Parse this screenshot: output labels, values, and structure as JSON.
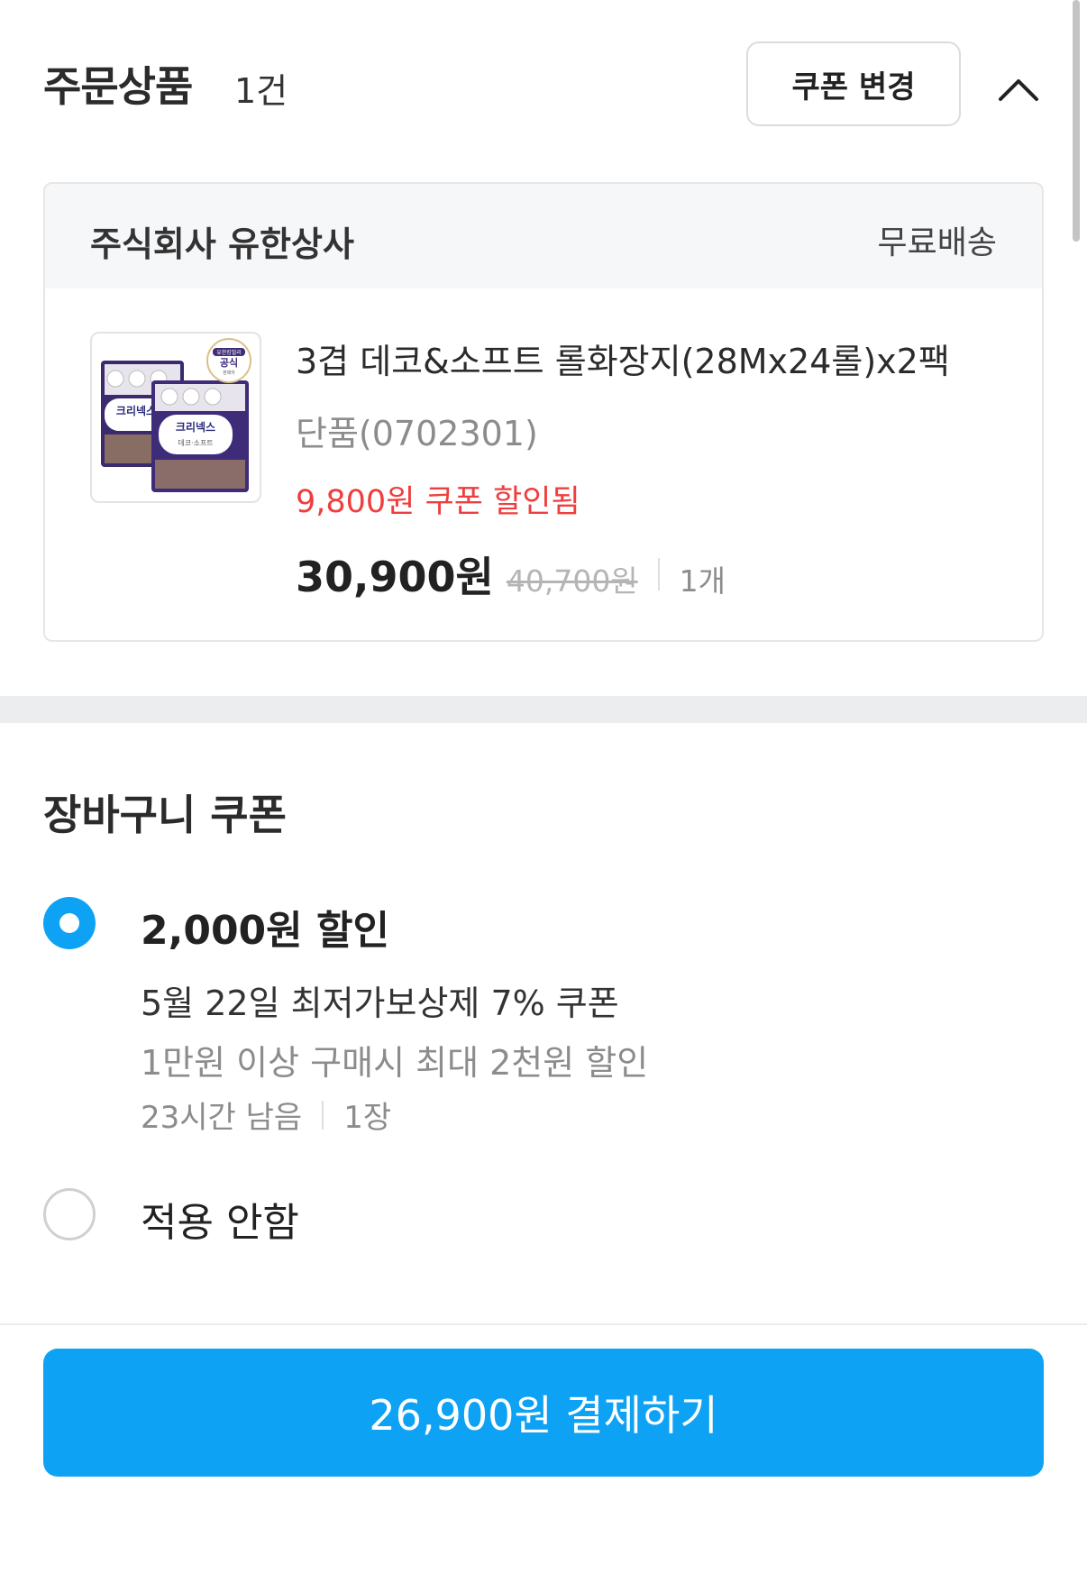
{
  "order": {
    "title": "주문상품",
    "count": "1건",
    "coupon_change_label": "쿠폰 변경",
    "collapse_icon": "chevron-up-icon"
  },
  "seller": {
    "name": "주식회사 유한상사",
    "shipping": "무료배송"
  },
  "product": {
    "name": "3겹 데코&소프트 롤화장지(28Mx24롤)x2팩",
    "option": "단품(0702301)",
    "coupon_applied": "9,800원 쿠폰 할인됨",
    "price": "30,900원",
    "original_price": "40,700원",
    "quantity": "1개",
    "image": {
      "brand": "크리넥스",
      "sub": "데코·소프트",
      "badge_top": "유한킴벌리",
      "badge_main": "공식",
      "badge_bottom": "판매자"
    }
  },
  "basket_coupon": {
    "title": "장바구니 쿠폰",
    "selected_option": {
      "discount": "2,000원 할인",
      "name": "5월 22일 최저가보상제 7% 쿠폰",
      "condition": "1만원 이상 구매시 최대 2천원 할인",
      "remaining": "23시간 남음",
      "count": "1장"
    },
    "no_apply_label": "적용 안함"
  },
  "checkout": {
    "label": "26,900원 결제하기"
  },
  "colors": {
    "accent": "#0ea2f5",
    "coupon_red": "#ef3e3e",
    "muted": "#8c8c8c"
  }
}
